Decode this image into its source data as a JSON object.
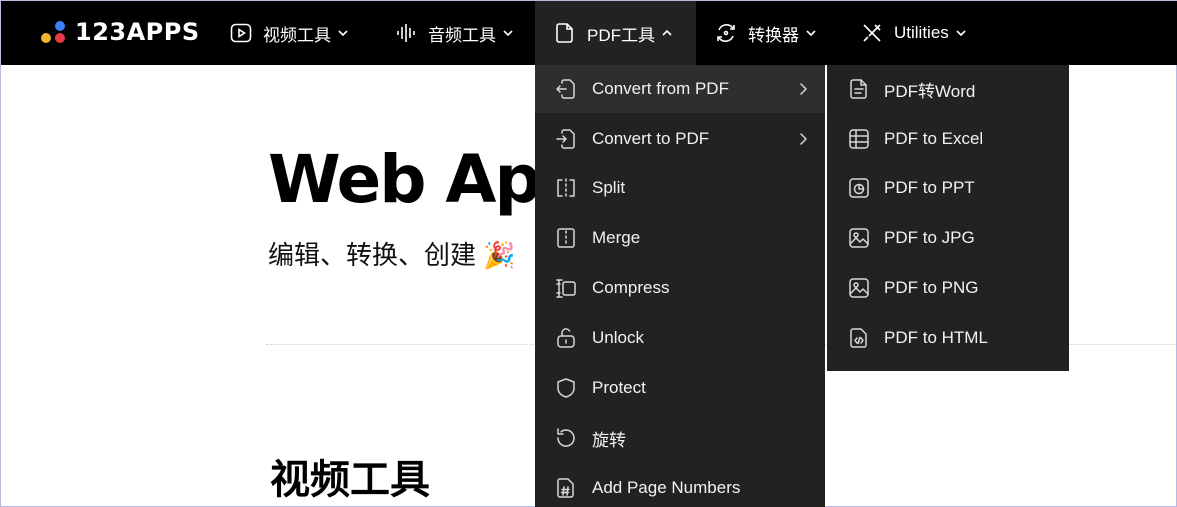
{
  "brand": {
    "name": "123APPS"
  },
  "nav": {
    "items": [
      {
        "label": "视频工具",
        "icon": "play-icon"
      },
      {
        "label": "音频工具",
        "icon": "waveform-icon"
      },
      {
        "label": "PDF工具",
        "icon": "document-icon",
        "active": true
      },
      {
        "label": "转换器",
        "icon": "convert-cycle-icon"
      },
      {
        "label": "Utilities",
        "icon": "tools-icon"
      }
    ]
  },
  "hero": {
    "title": "Web App",
    "subtitle": "编辑、转换、创建 🎉"
  },
  "section": {
    "title": "视频工具"
  },
  "pdf_menu": {
    "items": [
      {
        "label": "Convert from PDF",
        "icon": "convert-from-icon",
        "has_submenu": true,
        "highlighted": true
      },
      {
        "label": "Convert to PDF",
        "icon": "convert-to-icon",
        "has_submenu": true
      },
      {
        "label": "Split",
        "icon": "split-icon"
      },
      {
        "label": "Merge",
        "icon": "merge-icon"
      },
      {
        "label": "Compress",
        "icon": "compress-icon"
      },
      {
        "label": "Unlock",
        "icon": "unlock-icon"
      },
      {
        "label": "Protect",
        "icon": "shield-icon"
      },
      {
        "label": "旋转",
        "icon": "rotate-icon"
      },
      {
        "label": "Add Page Numbers",
        "icon": "page-number-icon"
      }
    ]
  },
  "submenu": {
    "items": [
      {
        "label": "PDF转Word",
        "icon": "word-doc-icon"
      },
      {
        "label": "PDF to Excel",
        "icon": "spreadsheet-icon"
      },
      {
        "label": "PDF to PPT",
        "icon": "presentation-icon"
      },
      {
        "label": "PDF to JPG",
        "icon": "image-icon"
      },
      {
        "label": "PDF to PNG",
        "icon": "image-icon"
      },
      {
        "label": "PDF to HTML",
        "icon": "code-file-icon"
      }
    ]
  },
  "colors": {
    "nav_bg": "#000000",
    "menu_bg": "#222222",
    "menu_hover": "#2e2e2e",
    "logo_yellow": "#f0b52c",
    "logo_red": "#e43a45",
    "logo_blue": "#3b82f6"
  }
}
